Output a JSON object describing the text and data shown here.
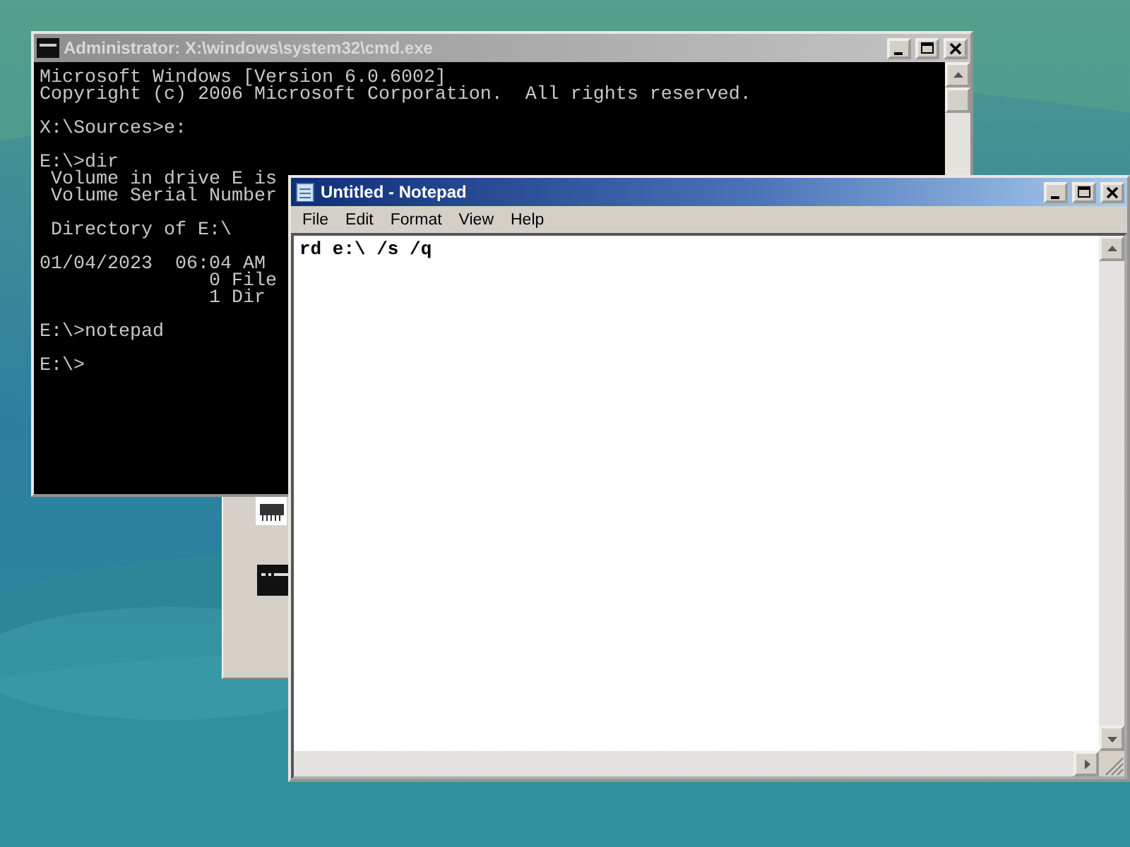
{
  "windows": [
    {
      "kind": "console",
      "title": "Administrator: X:\\windows\\system32\\cmd.exe",
      "active": false,
      "paragraphs": [
        [
          "Microsoft Windows [Version 6.0.6002]",
          "Copyright (c) 2006 Microsoft Corporation.  All rights reserved."
        ],
        [
          "X:\\Sources>e:"
        ],
        [
          "E:\\>dir",
          " Volume in drive E is",
          " Volume Serial Number"
        ],
        [
          " Directory of E:\\"
        ],
        [
          "01/04/2023  06:04 AM",
          "               0 File",
          "               1 Dir"
        ],
        [
          "E:\\>notepad"
        ],
        [
          "E:\\>"
        ]
      ]
    },
    {
      "kind": "notepad",
      "title": "Untitled - Notepad",
      "active": true,
      "menu": [
        "File",
        "Edit",
        "Format",
        "View",
        "Help"
      ],
      "text": "rd e:\\ /s /q"
    }
  ]
}
